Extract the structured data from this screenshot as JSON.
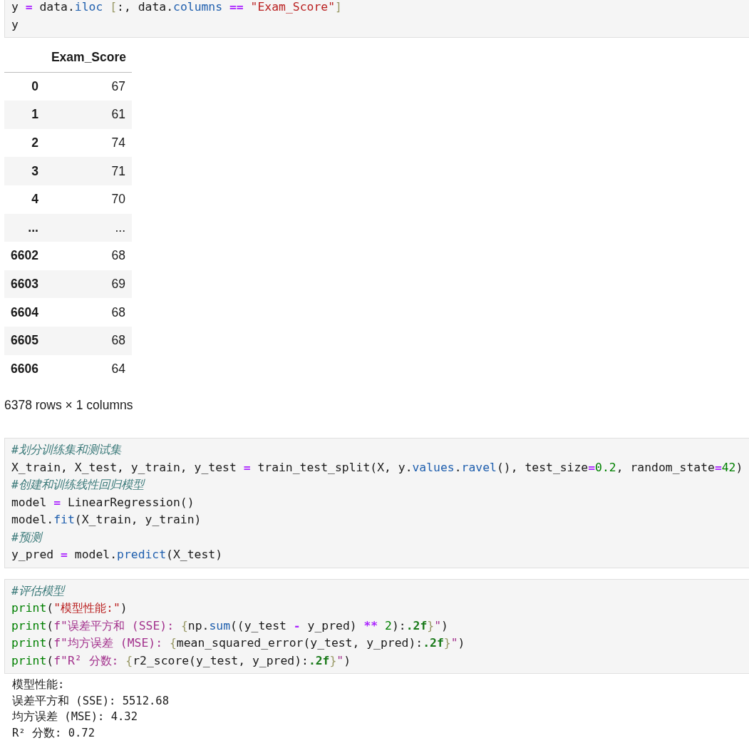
{
  "cells": [
    {
      "kind": "code",
      "lines": [
        [
          {
            "text": "y ",
            "kind": "name"
          },
          {
            "text": "=",
            "kind": "op"
          },
          {
            "text": " data.",
            "kind": "name"
          },
          {
            "text": "iloc",
            "kind": "attr"
          },
          {
            "text": " [",
            "kind": "brace"
          },
          {
            "text": ":, data.",
            "kind": "name"
          },
          {
            "text": "columns ",
            "kind": "attr"
          },
          {
            "text": "==",
            "kind": "op"
          },
          {
            "text": " \"Exam_Score\"",
            "kind": "str"
          },
          {
            "text": "]",
            "kind": "brace"
          }
        ],
        [
          {
            "text": "y",
            "kind": "name"
          }
        ]
      ]
    },
    {
      "kind": "table",
      "columns": [
        "Exam_Score"
      ],
      "rows": [
        {
          "index": "0",
          "values": [
            "67"
          ]
        },
        {
          "index": "1",
          "values": [
            "61"
          ]
        },
        {
          "index": "2",
          "values": [
            "74"
          ]
        },
        {
          "index": "3",
          "values": [
            "71"
          ]
        },
        {
          "index": "4",
          "values": [
            "70"
          ]
        },
        {
          "index": "...",
          "values": [
            "..."
          ]
        },
        {
          "index": "6602",
          "values": [
            "68"
          ]
        },
        {
          "index": "6603",
          "values": [
            "69"
          ]
        },
        {
          "index": "6604",
          "values": [
            "68"
          ]
        },
        {
          "index": "6605",
          "values": [
            "68"
          ]
        },
        {
          "index": "6606",
          "values": [
            "64"
          ]
        }
      ],
      "footer": "6378 rows × 1 columns"
    },
    {
      "kind": "code",
      "lines": [
        [
          {
            "text": "#划分训练集和测试集",
            "kind": "comment"
          }
        ],
        [
          {
            "text": "X_train, X_test, y_train, y_test ",
            "kind": "name"
          },
          {
            "text": "=",
            "kind": "op"
          },
          {
            "text": " train_test_split(X, y.",
            "kind": "name"
          },
          {
            "text": "values",
            "kind": "attr"
          },
          {
            "text": ".",
            "kind": "name"
          },
          {
            "text": "ravel",
            "kind": "attr"
          },
          {
            "text": "(), test_size",
            "kind": "name"
          },
          {
            "text": "=",
            "kind": "op"
          },
          {
            "text": "0.2",
            "kind": "num"
          },
          {
            "text": ", random_state",
            "kind": "name"
          },
          {
            "text": "=",
            "kind": "op"
          },
          {
            "text": "42",
            "kind": "num"
          },
          {
            "text": ")",
            "kind": "name"
          }
        ],
        [
          {
            "text": "#创建和训练线性回归模型",
            "kind": "comment"
          }
        ],
        [
          {
            "text": "model ",
            "kind": "name"
          },
          {
            "text": "=",
            "kind": "op"
          },
          {
            "text": " LinearRegression()",
            "kind": "name"
          }
        ],
        [
          {
            "text": "model.",
            "kind": "name"
          },
          {
            "text": "fit",
            "kind": "attr"
          },
          {
            "text": "(X_train, y_train)",
            "kind": "name"
          }
        ],
        [
          {
            "text": "#预测",
            "kind": "comment"
          }
        ],
        [
          {
            "text": "y_pred ",
            "kind": "name"
          },
          {
            "text": "=",
            "kind": "op"
          },
          {
            "text": " model.",
            "kind": "name"
          },
          {
            "text": "predict",
            "kind": "attr"
          },
          {
            "text": "(X_test)",
            "kind": "name"
          }
        ]
      ]
    },
    {
      "kind": "code",
      "lines": [
        [
          {
            "text": "#评估模型",
            "kind": "comment"
          }
        ],
        [
          {
            "text": "print",
            "kind": "builtin"
          },
          {
            "text": "(",
            "kind": "name"
          },
          {
            "text": "\"模型性能:\"",
            "kind": "str"
          },
          {
            "text": ")",
            "kind": "name"
          }
        ],
        [
          {
            "text": "print",
            "kind": "builtin"
          },
          {
            "text": "(",
            "kind": "name"
          },
          {
            "text": "f\"误差平方和 (SSE): ",
            "kind": "istr"
          },
          {
            "text": "{",
            "kind": "brace"
          },
          {
            "text": "np.",
            "kind": "name"
          },
          {
            "text": "sum",
            "kind": "attr"
          },
          {
            "text": "((y_test ",
            "kind": "name"
          },
          {
            "text": "-",
            "kind": "op"
          },
          {
            "text": " y_pred) ",
            "kind": "name"
          },
          {
            "text": "**",
            "kind": "op"
          },
          {
            "text": " 2",
            "kind": "num"
          },
          {
            "text": "):",
            "kind": "name"
          },
          {
            "text": ".2f",
            "kind": "fmt"
          },
          {
            "text": "}",
            "kind": "brace"
          },
          {
            "text": "\"",
            "kind": "istr"
          },
          {
            "text": ")",
            "kind": "name"
          }
        ],
        [
          {
            "text": "print",
            "kind": "builtin"
          },
          {
            "text": "(",
            "kind": "name"
          },
          {
            "text": "f\"均方误差 (MSE): ",
            "kind": "istr"
          },
          {
            "text": "{",
            "kind": "brace"
          },
          {
            "text": "mean_squared_error(y_test, y_pred):",
            "kind": "name"
          },
          {
            "text": ".2f",
            "kind": "fmt"
          },
          {
            "text": "}",
            "kind": "brace"
          },
          {
            "text": "\"",
            "kind": "istr"
          },
          {
            "text": ")",
            "kind": "name"
          }
        ],
        [
          {
            "text": "print",
            "kind": "builtin"
          },
          {
            "text": "(",
            "kind": "name"
          },
          {
            "text": "f\"R² 分数: ",
            "kind": "istr"
          },
          {
            "text": "{",
            "kind": "brace"
          },
          {
            "text": "r2_score(y_test, y_pred):",
            "kind": "name"
          },
          {
            "text": ".2f",
            "kind": "fmt"
          },
          {
            "text": "}",
            "kind": "brace"
          },
          {
            "text": "\"",
            "kind": "istr"
          },
          {
            "text": ")",
            "kind": "name"
          }
        ]
      ]
    },
    {
      "kind": "output",
      "lines": [
        "模型性能:",
        "误差平方和 (SSE): 5512.68",
        "均方误差 (MSE): 4.32",
        "R² 分数: 0.72"
      ]
    }
  ]
}
